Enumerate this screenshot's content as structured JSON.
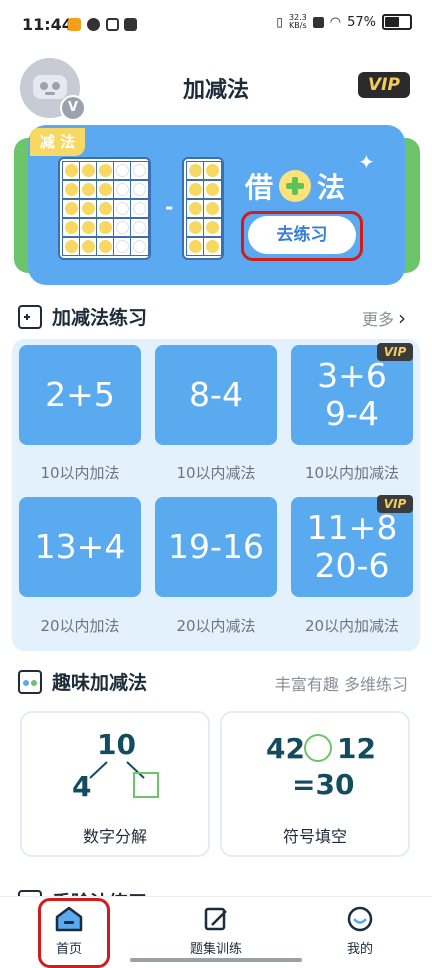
{
  "status_bar": {
    "time": "11:44",
    "net_speed_value": "32.3",
    "net_speed_unit": "KB/s",
    "battery": "57%",
    "icons": [
      "video-app-icon",
      "shield-app-icon",
      "f-app-icon",
      "message-app-icon",
      "vibrate-icon",
      "x-app-icon",
      "wifi-icon",
      "battery-icon"
    ]
  },
  "header": {
    "title": "加减法",
    "vip_label": "VIP",
    "avatar_badge": "V"
  },
  "banner": {
    "tag": "减 法",
    "minus_sign": "-",
    "title_left": "借",
    "title_right": "法",
    "button_label": "去练习",
    "colors": {
      "background": "#5ba9f0",
      "dot": "#f7d863"
    }
  },
  "practice_section": {
    "title": "加减法练习",
    "more_label": "更多",
    "cards": [
      {
        "lines": [
          "2+5"
        ],
        "label": "10以内加法",
        "vip": false
      },
      {
        "lines": [
          "8-4"
        ],
        "label": "10以内减法",
        "vip": false
      },
      {
        "lines": [
          "3+6",
          "9-4"
        ],
        "label": "10以内加减法",
        "vip": true,
        "vip_label": "VIP"
      },
      {
        "lines": [
          "13+4"
        ],
        "label": "20以内加法",
        "vip": false
      },
      {
        "lines": [
          "19-16"
        ],
        "label": "20以内减法",
        "vip": false
      },
      {
        "lines": [
          "11+8",
          "20-6"
        ],
        "label": "20以内加减法",
        "vip": true,
        "vip_label": "VIP"
      }
    ]
  },
  "fun_section": {
    "title": "趣味加减法",
    "subtitle": "丰富有趣 多维练习",
    "cards": [
      {
        "label": "数字分解",
        "top_number": "10",
        "left_number": "4"
      },
      {
        "label": "符号填空",
        "left_number": "42",
        "right_number": "12",
        "result": "=30"
      }
    ]
  },
  "partial_section": {
    "title": "乘除法练习"
  },
  "bottom_nav": {
    "items": [
      {
        "label": "首页",
        "icon": "home-icon",
        "active": true
      },
      {
        "label": "题集训练",
        "icon": "edit-icon",
        "active": false
      },
      {
        "label": "我的",
        "icon": "profile-icon",
        "active": false
      }
    ]
  }
}
